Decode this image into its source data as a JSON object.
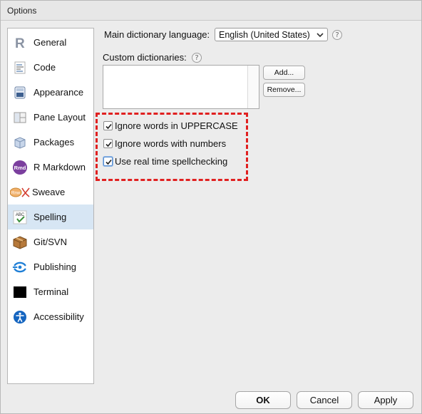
{
  "window": {
    "title": "Options"
  },
  "sidebar": {
    "items": [
      {
        "label": "General",
        "icon": "r-logo-icon"
      },
      {
        "label": "Code",
        "icon": "code-icon"
      },
      {
        "label": "Appearance",
        "icon": "appearance-icon"
      },
      {
        "label": "Pane Layout",
        "icon": "pane-layout-icon"
      },
      {
        "label": "Packages",
        "icon": "packages-icon"
      },
      {
        "label": "R Markdown",
        "icon": "rmarkdown-icon"
      },
      {
        "label": "Sweave",
        "icon": "sweave-icon"
      },
      {
        "label": "Spelling",
        "icon": "spelling-icon",
        "selected": true
      },
      {
        "label": "Git/SVN",
        "icon": "git-svn-icon"
      },
      {
        "label": "Publishing",
        "icon": "publishing-icon"
      },
      {
        "label": "Terminal",
        "icon": "terminal-icon"
      },
      {
        "label": "Accessibility",
        "icon": "accessibility-icon"
      }
    ],
    "rmd_icon_text": "Rmd",
    "sweave_icon_text": "Rnw",
    "spelling_icon_text": "ABC"
  },
  "spelling": {
    "dictionary_label": "Main dictionary language:",
    "dictionary_value": "English (United States)",
    "custom_dictionaries_label": "Custom dictionaries:",
    "help_glyph": "?",
    "add_button": "Add...",
    "remove_button": "Remove...",
    "options": [
      {
        "label": "Ignore words in UPPERCASE",
        "checked": true
      },
      {
        "label": "Ignore words with numbers",
        "checked": true
      },
      {
        "label": "Use real time spellchecking",
        "checked": true
      }
    ]
  },
  "footer": {
    "ok": "OK",
    "cancel": "Cancel",
    "apply": "Apply"
  },
  "colors": {
    "selection": "#d7e6f4",
    "highlight_dash": "#e02020",
    "publishing_blue": "#1f7fd6",
    "accessibility_blue": "#1565c0",
    "rmd_purple": "#7b3f9e"
  }
}
